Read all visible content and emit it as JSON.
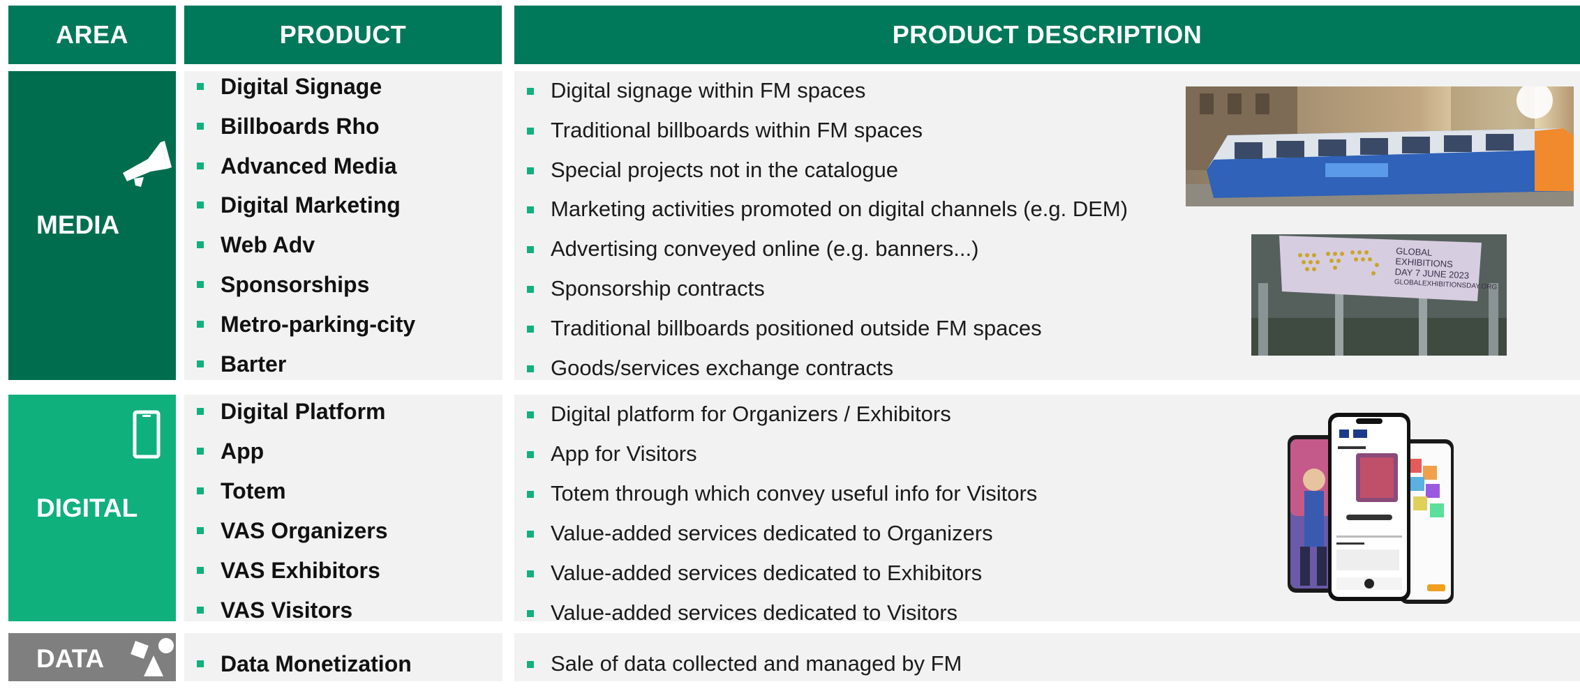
{
  "header": {
    "area": "AREA",
    "product": "PRODUCT",
    "description": "PRODUCT DESCRIPTION"
  },
  "colors": {
    "header_green": "#00785a",
    "media_green": "#006e4e",
    "digital_green": "#10b07c",
    "data_gray": "#7f7f7f",
    "bullet_green": "#11b07e",
    "panel_gray": "#f2f2f2"
  },
  "sections": {
    "media": {
      "area_label": "MEDIA",
      "icon": "megaphone-icon",
      "products": [
        "Digital Signage",
        "Billboards Rho",
        "Advanced Media",
        "Digital Marketing",
        "Web Adv",
        "Sponsorships",
        "Metro-parking-city",
        "Barter"
      ],
      "descriptions": [
        "Digital signage within FM spaces",
        "Traditional billboards within FM spaces",
        "Special projects not in the catalogue",
        "Marketing activities promoted on digital channels (e.g. DEM)",
        "Advertising conveyed online (e.g. banners...)",
        "Sponsorship contracts",
        "Traditional billboards positioned outside FM spaces",
        "Goods/services exchange contracts"
      ],
      "images": {
        "tram_ad": {
          "icon": "tram-advertising-photo"
        },
        "billboard": {
          "icon": "billboard-photo",
          "banner_lines": [
            "GLOBAL",
            "EXHIBITIONS",
            "DAY 7 JUNE 2023",
            "GLOBALEXHIBITIONSDAY.ORG"
          ]
        }
      }
    },
    "digital": {
      "area_label": "DIGITAL",
      "icon": "smartphone-icon",
      "products": [
        "Digital Platform",
        "App",
        "Totem",
        "VAS Organizers",
        "VAS Exhibitors",
        "VAS Visitors"
      ],
      "descriptions": [
        "Digital platform for Organizers / Exhibitors",
        "App for Visitors",
        "Totem through which convey useful info for Visitors",
        "Value-added services dedicated to Organizers",
        "Value-added services dedicated to Exhibitors",
        "Value-added services dedicated to Visitors"
      ],
      "images": {
        "phones": {
          "icon": "app-phones-mockup"
        }
      }
    },
    "data": {
      "area_label": "DATA",
      "icon": "shapes-icon",
      "products": [
        "Data Monetization"
      ],
      "descriptions": [
        "Sale of data collected and managed by FM"
      ]
    }
  }
}
